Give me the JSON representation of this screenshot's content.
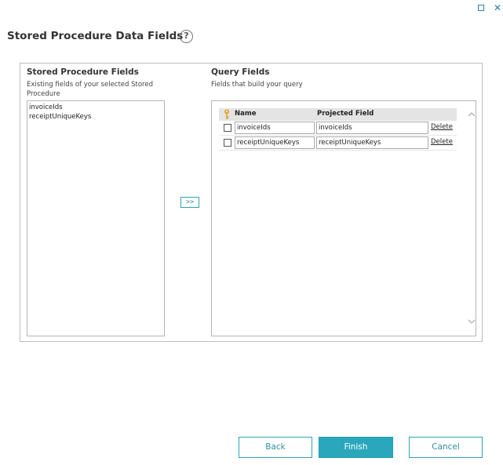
{
  "window": {
    "maximize_icon": "maximize-icon",
    "close_icon": "close-icon",
    "close_glyph": "✕"
  },
  "header": {
    "title": "Stored Procedure Data Fields",
    "help_glyph": "?"
  },
  "left_panel": {
    "title": "Stored Procedure Fields",
    "subtitle_line1": "Existing fields of your selected Stored",
    "subtitle_line2": "Procedure",
    "items": [
      "invoiceIds",
      "receiptUniqueKeys"
    ]
  },
  "move_button": {
    "label": ">>"
  },
  "right_panel": {
    "title": "Query Fields",
    "subtitle": "Fields that build your query",
    "columns": {
      "name": "Name",
      "projected": "Projected Field"
    },
    "rows": [
      {
        "name": "invoiceIds",
        "projected": "invoiceIds",
        "delete_label": "Delete"
      },
      {
        "name": "receiptUniqueKeys",
        "projected": "receiptUniqueKeys",
        "delete_label": "Delete"
      }
    ]
  },
  "footer": {
    "back_label": "Back",
    "finish_label": "Finish",
    "cancel_label": "Cancel"
  },
  "colors": {
    "accent": "#2aa7bb",
    "accent_text": "#2a8fa0"
  }
}
